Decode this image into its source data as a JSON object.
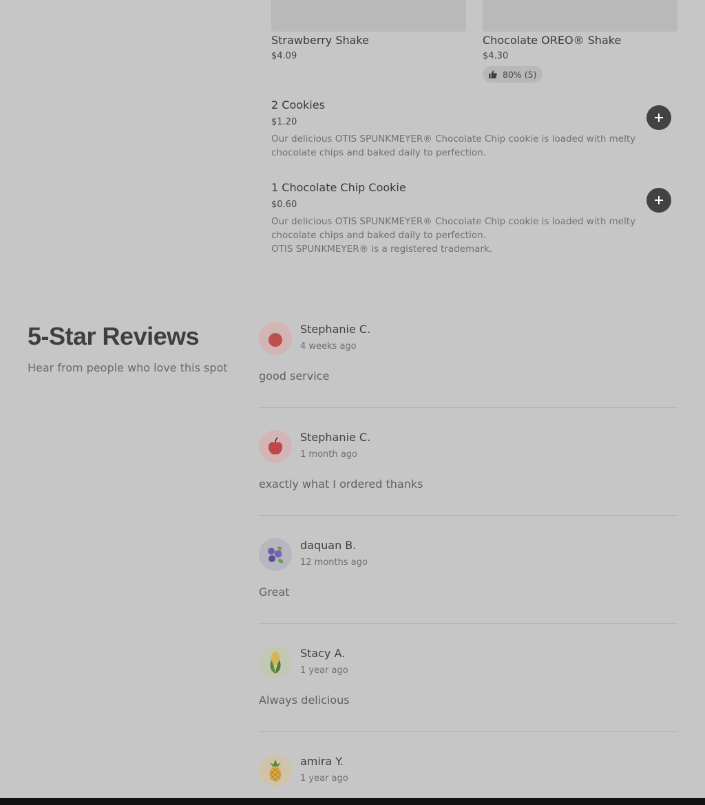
{
  "menu": {
    "cards": [
      {
        "name": "Strawberry Shake",
        "price": "$4.09"
      },
      {
        "name": "Chocolate OREO® Shake",
        "price": "$4.30",
        "rating": "80% (5)"
      }
    ],
    "items": [
      {
        "name": "2 Cookies",
        "price": "$1.20",
        "description": "Our delicious OTIS SPUNKMEYER® Chocolate Chip cookie is loaded with melty chocolate chips and baked daily to perfection."
      },
      {
        "name": "1 Chocolate Chip Cookie",
        "price": "$0.60",
        "description": "Our delicious OTIS SPUNKMEYER® Chocolate Chip cookie is loaded with melty chocolate chips and baked daily to perfection.",
        "note": "OTIS SPUNKMEYER® is a registered trademark."
      }
    ]
  },
  "reviews": {
    "title": "5-Star Reviews",
    "subtitle": "Hear from people who love this spot",
    "list": [
      {
        "name": "Stephanie C.",
        "time": "4 weeks ago",
        "text": "good service",
        "avatar_icon": "tomato-icon",
        "avatar_bg": "#d3b5b5"
      },
      {
        "name": "Stephanie C.",
        "time": "1 month ago",
        "text": "exactly what I ordered thanks",
        "avatar_icon": "apple-icon",
        "avatar_bg": "#d3b5b5"
      },
      {
        "name": "daquan B.",
        "time": "12 months ago",
        "text": "Great",
        "avatar_icon": "blueberries-icon",
        "avatar_bg": "#b8b6bf"
      },
      {
        "name": "Stacy A.",
        "time": "1 year ago",
        "text": "Always delicious",
        "avatar_icon": "corn-icon",
        "avatar_bg": "#c3c8b2"
      },
      {
        "name": "amira Y.",
        "time": "1 year ago",
        "avatar_icon": "pineapple-icon",
        "avatar_bg": "#cfc4ab"
      }
    ]
  },
  "icons": {
    "rating": "thumbs-up-icon",
    "add": "plus-icon"
  },
  "colors": {
    "button": "#424242",
    "background": "#c6c6c6"
  }
}
